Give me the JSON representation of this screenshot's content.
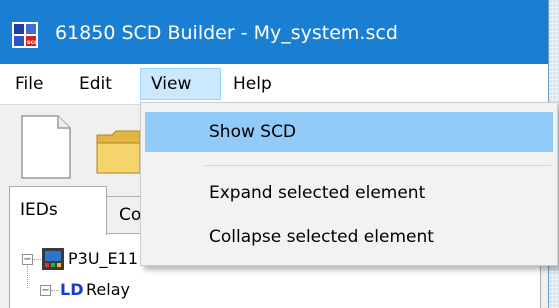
{
  "window": {
    "title": "61850 SCD Builder - My_system.scd",
    "title_bar_color": "#1a7ed3",
    "app_icon": "scd-app-icon"
  },
  "menu": {
    "items": [
      {
        "label": "File"
      },
      {
        "label": "Edit"
      },
      {
        "label": "View",
        "open": true
      },
      {
        "label": "Help"
      }
    ]
  },
  "view_menu": {
    "items": [
      {
        "label": "Show SCD",
        "highlighted": true
      },
      {
        "label": "Expand selected element"
      },
      {
        "label": "Collapse selected element"
      }
    ],
    "highlight_color": "#91c9f7"
  },
  "toolbar": {
    "buttons": [
      {
        "icon": "new-document-icon"
      },
      {
        "icon": "open-folder-icon"
      }
    ]
  },
  "tabs": [
    {
      "label": "IEDs",
      "active": true
    },
    {
      "label": "Co"
    }
  ],
  "tree": {
    "nodes": [
      {
        "label": "P3U_E11",
        "icon": "ied-device-icon",
        "expanded": true
      },
      {
        "prefix": "LD",
        "label": "Relay",
        "icon": "logical-device-icon",
        "expanded": true
      }
    ],
    "ld_color": "#1a3cc8"
  }
}
